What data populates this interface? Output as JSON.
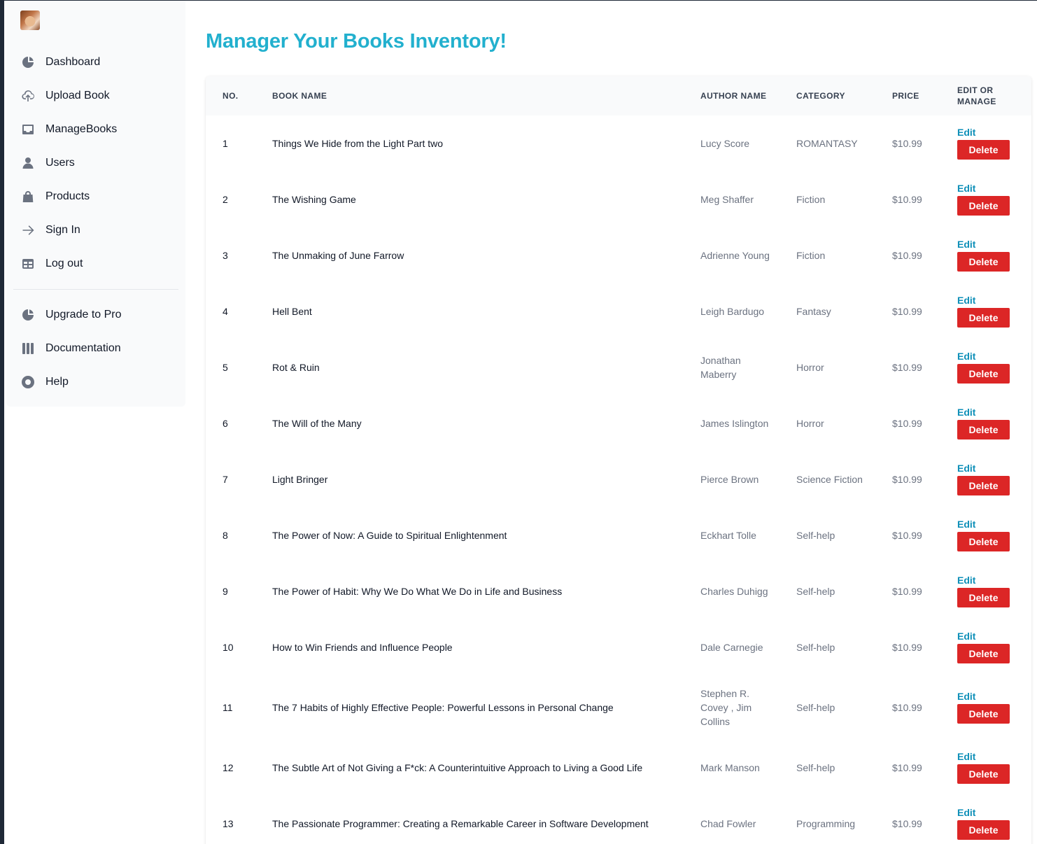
{
  "sidebar": {
    "items": [
      {
        "label": "Dashboard",
        "icon": "pie-chart-icon"
      },
      {
        "label": "Upload Book",
        "icon": "cloud-upload-icon"
      },
      {
        "label": "ManageBooks",
        "icon": "inbox-icon"
      },
      {
        "label": "Users",
        "icon": "user-icon"
      },
      {
        "label": "Products",
        "icon": "shopping-bag-icon"
      },
      {
        "label": "Sign In",
        "icon": "arrow-right-icon"
      },
      {
        "label": "Log out",
        "icon": "table-icon"
      }
    ],
    "secondary_items": [
      {
        "label": "Upgrade to Pro",
        "icon": "pie-chart-icon"
      },
      {
        "label": "Documentation",
        "icon": "columns-icon"
      },
      {
        "label": "Help",
        "icon": "lifebuoy-icon"
      }
    ]
  },
  "main": {
    "title": "Manager Your Books Inventory!",
    "columns": [
      "No.",
      "Book Name",
      "Author Name",
      "Category",
      "Price",
      "Edit or Manage"
    ],
    "edit_label": "Edit",
    "delete_label": "Delete",
    "rows": [
      {
        "no": "1",
        "name": "Things We Hide from the Light Part two",
        "author": "Lucy Score",
        "category": "ROMANTASY",
        "price": "$10.99"
      },
      {
        "no": "2",
        "name": "The Wishing Game",
        "author": "Meg Shaffer",
        "category": "Fiction",
        "price": "$10.99"
      },
      {
        "no": "3",
        "name": "The Unmaking of June Farrow",
        "author": "Adrienne Young",
        "category": "Fiction",
        "price": "$10.99"
      },
      {
        "no": "4",
        "name": "Hell Bent",
        "author": "Leigh Bardugo",
        "category": "Fantasy",
        "price": "$10.99"
      },
      {
        "no": "5",
        "name": "Rot & Ruin",
        "author": "Jonathan Maberry",
        "category": "Horror",
        "price": "$10.99"
      },
      {
        "no": "6",
        "name": "The Will of the Many",
        "author": "James Islington",
        "category": "Horror",
        "price": "$10.99"
      },
      {
        "no": "7",
        "name": "Light Bringer",
        "author": "Pierce Brown",
        "category": "Science Fiction",
        "price": "$10.99"
      },
      {
        "no": "8",
        "name": "The Power of Now: A Guide to Spiritual Enlightenment",
        "author": "Eckhart Tolle",
        "category": "Self-help",
        "price": "$10.99"
      },
      {
        "no": "9",
        "name": "The Power of Habit: Why We Do What We Do in Life and Business",
        "author": "Charles Duhigg",
        "category": "Self-help",
        "price": "$10.99"
      },
      {
        "no": "10",
        "name": "How to Win Friends and Influence People",
        "author": "Dale Carnegie",
        "category": "Self-help",
        "price": "$10.99"
      },
      {
        "no": "11",
        "name": "The 7 Habits of Highly Effective People: Powerful Lessons in Personal Change",
        "author": "Stephen R. Covey , Jim Collins",
        "category": "Self-help",
        "price": "$10.99"
      },
      {
        "no": "12",
        "name": "The Subtle Art of Not Giving a F*ck: A Counterintuitive Approach to Living a Good Life",
        "author": "Mark Manson",
        "category": "Self-help",
        "price": "$10.99"
      },
      {
        "no": "13",
        "name": "The Passionate Programmer: Creating a Remarkable Career in Software Development",
        "author": "Chad Fowler",
        "category": "Programming",
        "price": "$10.99"
      }
    ]
  },
  "colors": {
    "title": "#22b0ce",
    "edit_link": "#0e8fb8",
    "delete_button": "#dc2626",
    "sidebar_bg": "#f9fafb"
  }
}
